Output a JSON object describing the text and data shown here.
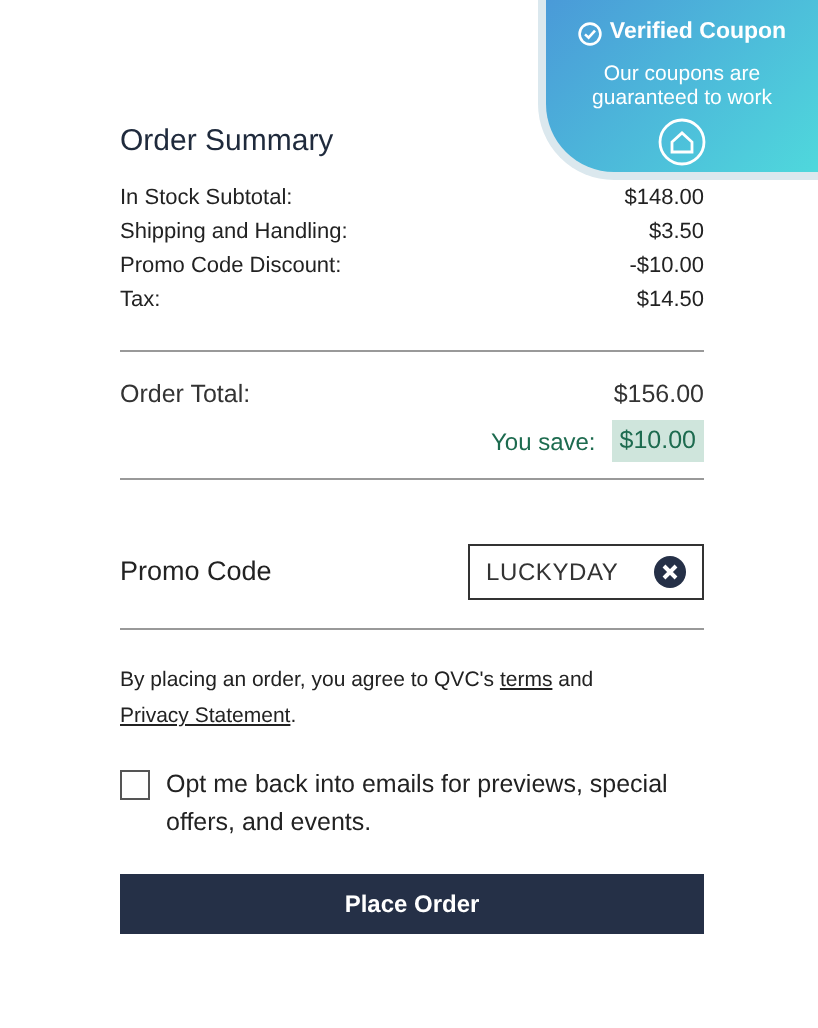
{
  "coupon_badge": {
    "title": "Verified Coupon",
    "message": "Our coupons are guaranteed to work"
  },
  "summary": {
    "title": "Order Summary",
    "lines": [
      {
        "label": "In Stock Subtotal:",
        "value": "$148.00"
      },
      {
        "label": "Shipping and Handling:",
        "value": "$3.50"
      },
      {
        "label": "Promo Code Discount:",
        "value": "-$10.00"
      },
      {
        "label": "Tax:",
        "value": "$14.50"
      }
    ],
    "total_label": "Order Total:",
    "total_value": "$156.00",
    "save_label": "You save:",
    "save_value": "$10.00"
  },
  "promo": {
    "label": "Promo Code",
    "code": "LUCKYDAY"
  },
  "agreement": {
    "before": "By placing an order, you agree to QVC's ",
    "terms": "terms",
    "middle": " and ",
    "privacy": "Privacy Statement",
    "after": "."
  },
  "opt_in": {
    "label": "Opt me back into emails for previews, special offers, and events.",
    "checked": false
  },
  "place_order": "Place Order"
}
